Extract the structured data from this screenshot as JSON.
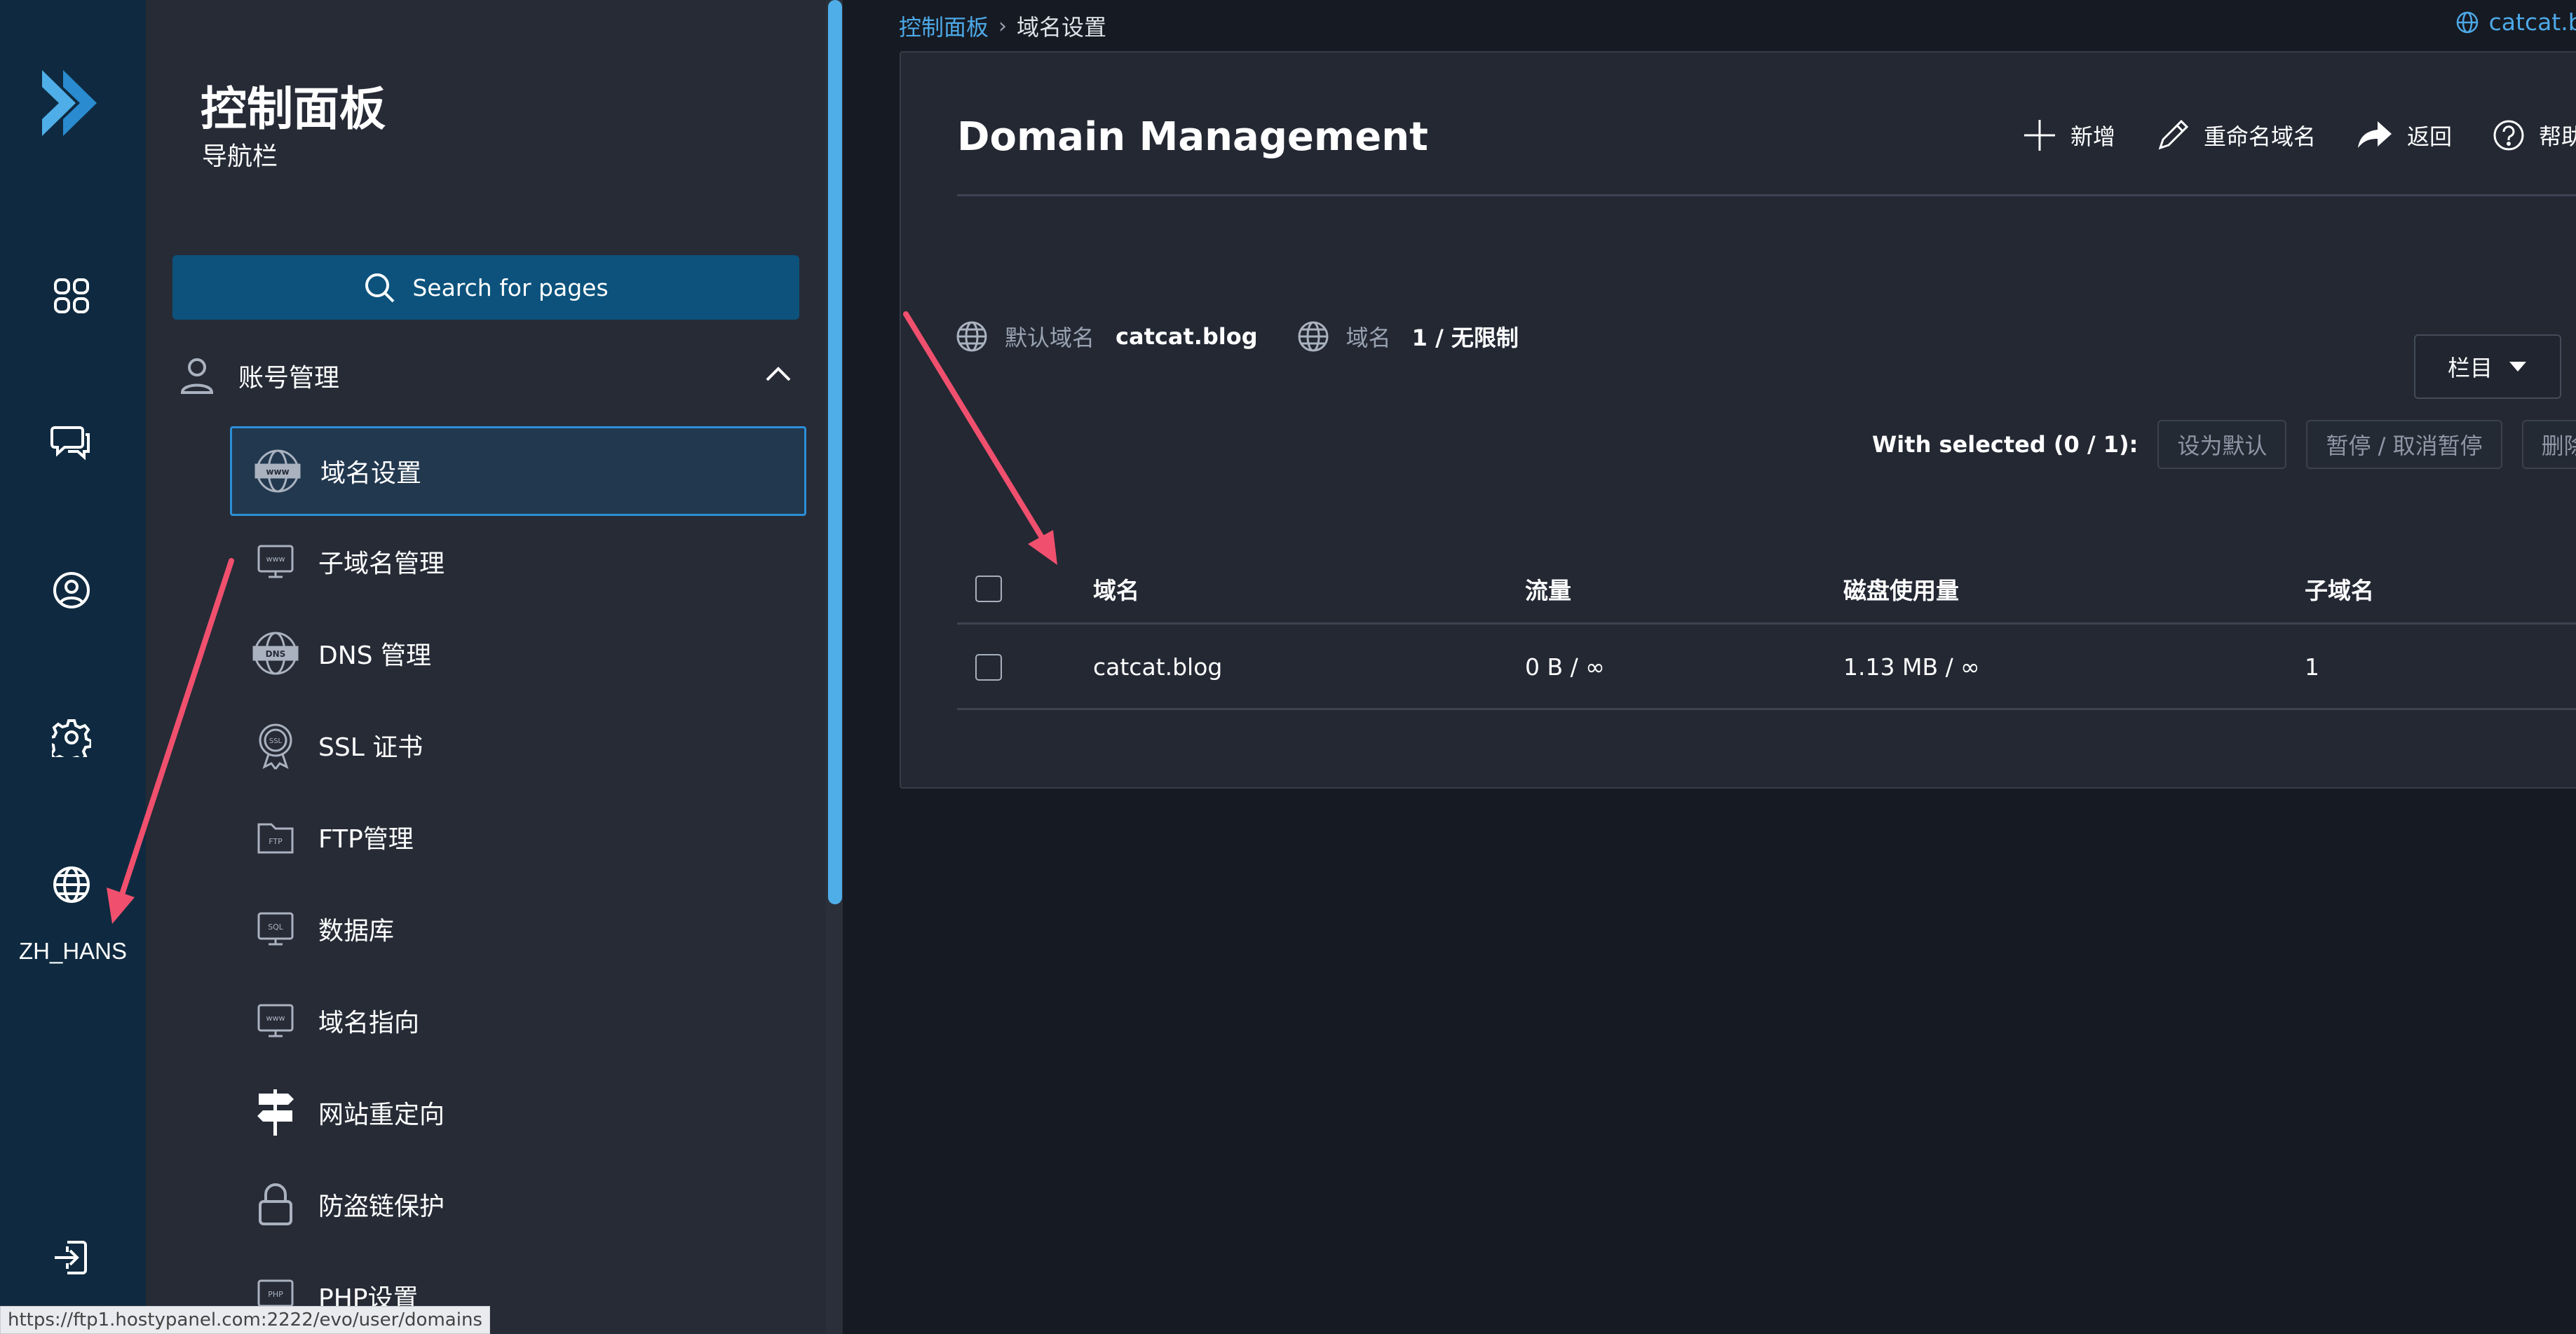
{
  "rail": {
    "lang_label": "ZH_HANS",
    "icons": [
      "dashboard-icon",
      "chat-icon",
      "user-icon",
      "gear-icon",
      "globe-icon",
      "logout-icon"
    ]
  },
  "nav": {
    "title": "控制面板",
    "subtitle": "导航栏",
    "search_label": "Search for pages",
    "group_label": "账号管理",
    "items": [
      {
        "label": "域名设置",
        "icon": "www-icon",
        "active": true
      },
      {
        "label": "子域名管理",
        "icon": "subdomain-icon"
      },
      {
        "label": "DNS 管理",
        "icon": "dns-icon"
      },
      {
        "label": "SSL 证书",
        "icon": "ssl-icon"
      },
      {
        "label": "FTP管理",
        "icon": "ftp-icon"
      },
      {
        "label": "数据库",
        "icon": "sql-icon"
      },
      {
        "label": "域名指向",
        "icon": "pointer-icon"
      },
      {
        "label": "网站重定向",
        "icon": "signpost-icon"
      },
      {
        "label": "防盗链保护",
        "icon": "lock-icon"
      },
      {
        "label": "PHP设置",
        "icon": "php-icon"
      }
    ]
  },
  "breadcrumb": {
    "root": "控制面板",
    "separator": "›",
    "current": "域名设置"
  },
  "header": {
    "user_domain": "catcat.blog"
  },
  "panel": {
    "title": "Domain Management",
    "toolbar": {
      "add": "新增",
      "rename": "重命名域名",
      "back": "返回",
      "help": "帮助"
    },
    "info": {
      "default_domain_label": "默认域名",
      "default_domain_value": "catcat.blog",
      "domains_label": "域名",
      "domains_value": "1 / 无限制"
    },
    "columns_button": "栏目",
    "bulk": {
      "label": "With selected (0 / 1):",
      "set_default": "设为默认",
      "suspend": "暂停 / 取消暂停",
      "delete": "删除"
    },
    "table": {
      "headers": [
        "域名",
        "流量",
        "磁盘使用量",
        "子域名"
      ],
      "rows": [
        {
          "domain": "catcat.blog",
          "traffic": "0 B / ∞",
          "disk": "1.13 MB / ∞",
          "subdomains": "1"
        }
      ]
    }
  },
  "status_bar": "https://ftp1.hostypanel.com:2222/evo/user/domains",
  "colors": {
    "rail_bg": "#0f2a40",
    "nav_bg": "#262b36",
    "main_bg": "#161a22",
    "accent": "#4da9e8",
    "search_bg": "#0c527c",
    "arrow": "#f0506e"
  }
}
